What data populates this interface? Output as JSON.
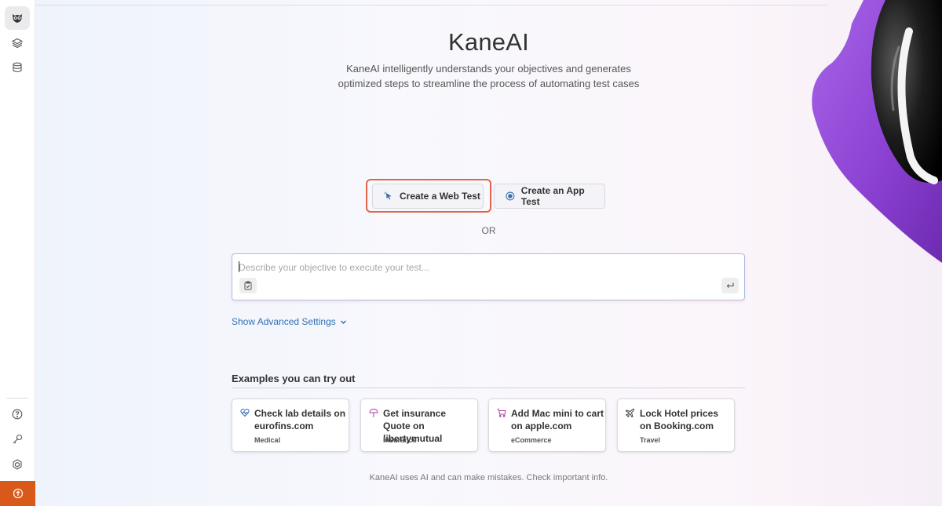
{
  "app": {
    "title": "KaneAI",
    "subtitle_line1": "KaneAI intelligently understands your objectives and generates",
    "subtitle_line2": "optimized steps to streamline the process of automating test cases"
  },
  "sidebar": {
    "top_items": [
      {
        "icon": "owl-logo-icon",
        "active": true
      },
      {
        "icon": "layers-icon"
      },
      {
        "icon": "database-icon"
      }
    ],
    "bottom_items": [
      {
        "icon": "help-circle-icon"
      },
      {
        "icon": "key-icon"
      },
      {
        "icon": "settings-hexagon-icon"
      },
      {
        "icon": "upgrade-arrow-icon"
      }
    ]
  },
  "actions": {
    "web_test_label": "Create a Web Test",
    "app_test_label": "Create an App Test",
    "or_label": "OR"
  },
  "prompt": {
    "placeholder": "Describe your objective to execute your test...",
    "value": ""
  },
  "advanced_settings_label": "Show Advanced Settings",
  "examples": {
    "heading": "Examples you can try out",
    "cards": [
      {
        "title": "Check lab details on eurofins.com",
        "category": "Medical",
        "icon": "heart-pulse-icon"
      },
      {
        "title": "Get insurance Quote on libertymutual",
        "category": "Insurance",
        "icon": "umbrella-icon"
      },
      {
        "title": "Add Mac mini to cart on apple.com",
        "category": "eCommerce",
        "icon": "cart-icon"
      },
      {
        "title": "Lock Hotel prices on Booking.com",
        "category": "Travel",
        "icon": "plane-icon"
      }
    ]
  },
  "footer_note": "KaneAI uses AI and can make mistakes. Check important info.",
  "colors": {
    "accent_blue": "#2f6fb7",
    "highlight_red": "#e3634a",
    "upgrade_orange": "#d9591a",
    "mascot_purple": "#8e3fd0"
  }
}
